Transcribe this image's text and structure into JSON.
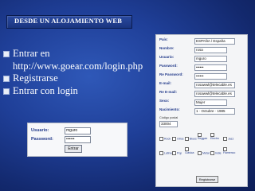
{
  "title": "DESDE UN ALOJAMIENTO WEB",
  "bullets": [
    "Entrar en http://www.goear.com/login.php",
    "Registrarse",
    "Entrar con login"
  ],
  "login_form": {
    "user_label": "Usuario:",
    "user_value": "mguro",
    "password_label": "Password:",
    "password_value": "••••••",
    "button_label": "Entrar"
  },
  "register_form": {
    "fields": [
      {
        "label": "País:",
        "value": "ESPAÑA / España"
      },
      {
        "label": "Nombre:",
        "value": "rosa"
      },
      {
        "label": "Usuario:",
        "value": "mguro"
      },
      {
        "label": "Password:",
        "value": "••••••"
      },
      {
        "label": "Re Password:",
        "value": "••••••"
      },
      {
        "label": "E-mail:",
        "value": "rosawwl@telecable.es"
      },
      {
        "label": "Re E-mail:",
        "value": "rosawwl@telecable.es"
      },
      {
        "label": "Sexo:",
        "value": "Mujer"
      },
      {
        "label": "Nacimiento:",
        "value": "1  ·  Octubre  ·  1985"
      }
    ],
    "cp_label": "Código postal",
    "cp_value": "33004",
    "styles": [
      "Rock",
      "Otros",
      "Blues",
      "Reggae",
      "Electro",
      "Jazz",
      "Latina",
      "Pop",
      "Clásica",
      "Metal",
      "Indie",
      "Flamenco"
    ],
    "button_label": "Registrarse"
  }
}
